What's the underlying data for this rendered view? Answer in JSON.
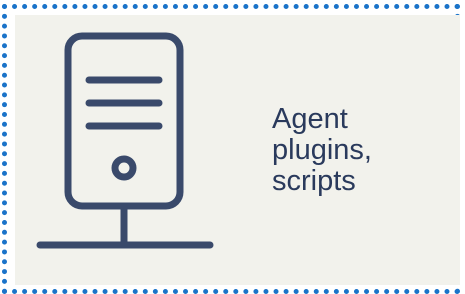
{
  "node": {
    "icon": "server-icon",
    "label": "Agent\nplugins,\nscripts"
  },
  "colors": {
    "border": "#1a73c9",
    "panel_bg": "#f2f2ec",
    "icon_stroke": "#3a4a6b",
    "text": "#2a3a5c"
  }
}
